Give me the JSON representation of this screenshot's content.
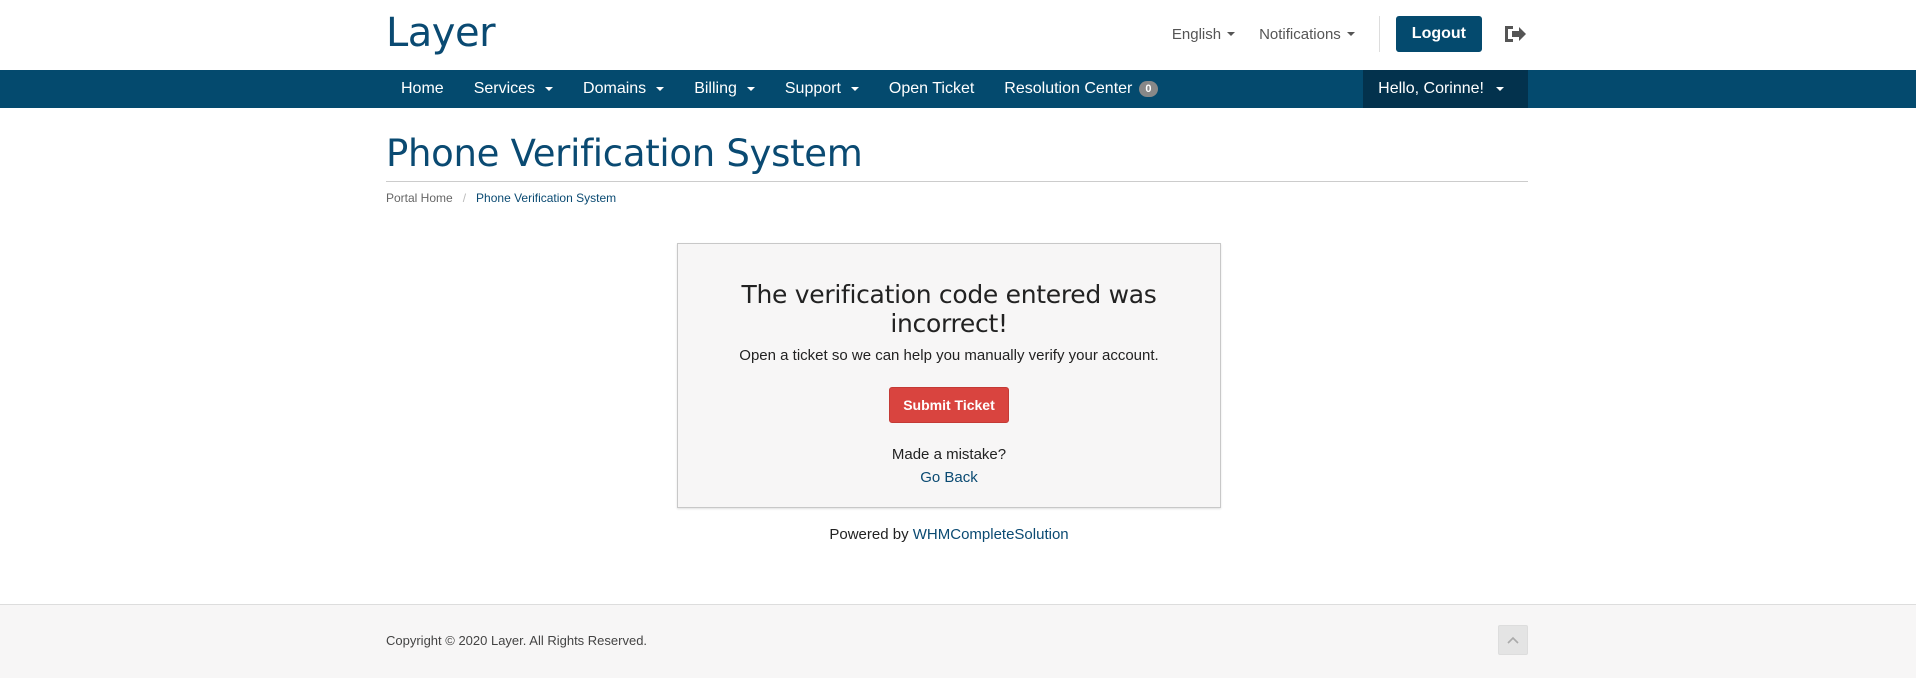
{
  "header": {
    "logo": "Layer",
    "language": "English",
    "notifications": "Notifications",
    "logout_label": "Logout"
  },
  "nav": {
    "items": [
      {
        "label": "Home",
        "dropdown": false
      },
      {
        "label": "Services",
        "dropdown": true
      },
      {
        "label": "Domains",
        "dropdown": true
      },
      {
        "label": "Billing",
        "dropdown": true
      },
      {
        "label": "Support",
        "dropdown": true
      },
      {
        "label": "Open Ticket",
        "dropdown": false
      },
      {
        "label": "Resolution Center",
        "dropdown": false
      }
    ],
    "resolution_badge": "0",
    "user_greeting": "Hello, Corinne!"
  },
  "page": {
    "title": "Phone Verification System",
    "breadcrumb": [
      "Portal Home",
      "Phone Verification System"
    ]
  },
  "panel": {
    "heading": "The verification code entered was incorrect!",
    "description": "Open a ticket so we can help you manually verify your account.",
    "submit_label": "Submit Ticket",
    "mistake_text": "Made a mistake?",
    "go_back_label": "Go Back"
  },
  "powered": {
    "prefix": "Powered by",
    "link": "WHMCompleteSolution"
  },
  "footer": {
    "copyright": "Copyright © 2020 Layer. All Rights Reserved."
  },
  "colors": {
    "brand": "#044a6e",
    "nav_user_bg": "#03324d",
    "danger": "#d9443f",
    "link": "#0a4a72"
  }
}
